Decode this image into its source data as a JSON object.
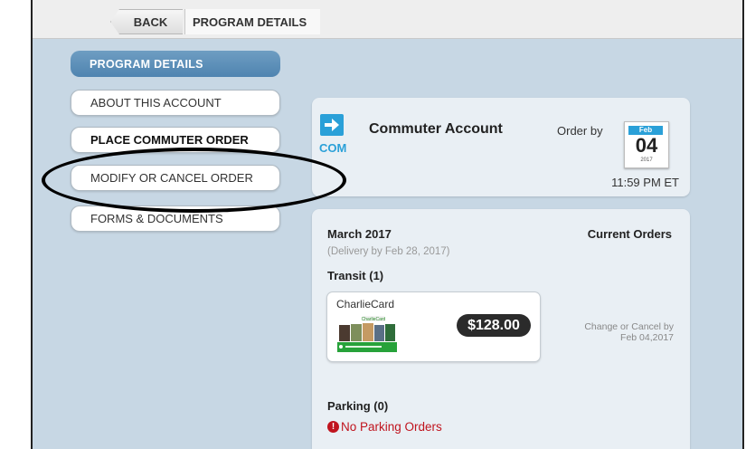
{
  "topbar": {
    "back_label": "BACK",
    "breadcrumb": "PROGRAM DETAILS"
  },
  "sidebar": {
    "items": [
      {
        "label": "PROGRAM DETAILS",
        "active": true
      },
      {
        "label": "ABOUT THIS ACCOUNT"
      },
      {
        "label": "PLACE COMMUTER ORDER"
      },
      {
        "label": "MODIFY OR CANCEL ORDER",
        "highlighted": true
      },
      {
        "label": "FORMS & DOCUMENTS"
      }
    ]
  },
  "account": {
    "icon_label": "COM",
    "title": "Commuter Account",
    "order_by_label": "Order by",
    "calendar": {
      "month": "Feb",
      "day": "04",
      "year": "2017"
    },
    "cutoff_time": "11:59 PM ET"
  },
  "orders": {
    "month": "March 2017",
    "delivery": "(Delivery by Feb 28, 2017)",
    "current_label": "Current Orders",
    "transit_label": "Transit (1)",
    "transit_item": {
      "name": "CharlieCard",
      "price": "$128.00"
    },
    "change_line1": "Change or Cancel by",
    "change_line2": "Feb 04,2017",
    "parking_label": "Parking (0)",
    "no_parking": "No Parking Orders"
  },
  "colors": {
    "accent": "#2aa0d8",
    "active_nav": "#5a8fba",
    "background": "#c7d7e4",
    "error": "#c0141e"
  },
  "icons": [
    "arrow-right-icon",
    "calendar-icon",
    "error-icon",
    "charliecard-image"
  ]
}
